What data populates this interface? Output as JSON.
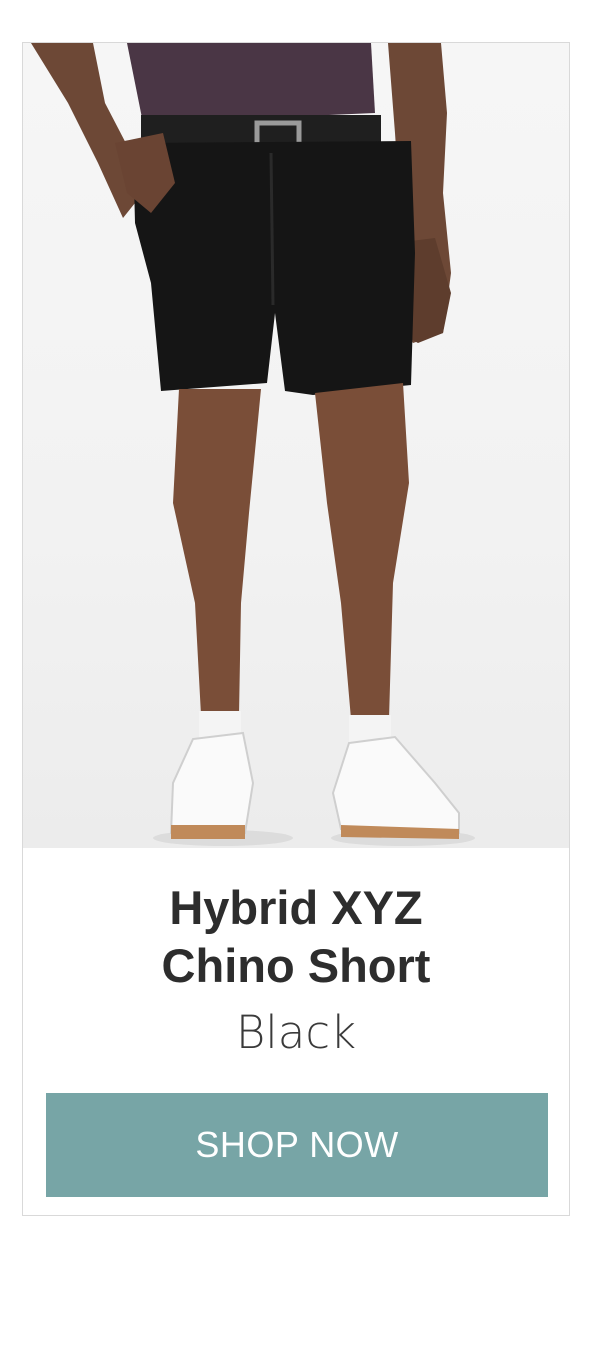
{
  "product": {
    "title_line1": "Hybrid XYZ",
    "title_line2": "Chino Short",
    "color": "Black",
    "image_icon": "product-photo-shorts"
  },
  "cta": {
    "label": "SHOP NOW",
    "background": "#77a5a6"
  }
}
